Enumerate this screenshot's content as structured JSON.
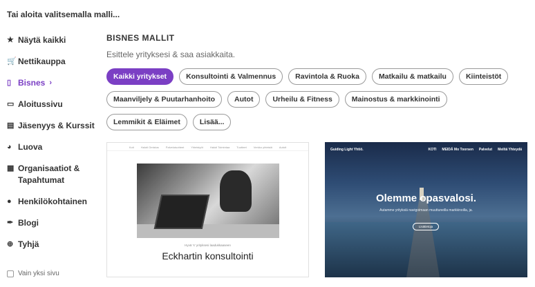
{
  "heading": "Tai aloita valitsemalla malli...",
  "sidebar": {
    "items": [
      {
        "label": "Näytä kaikki",
        "icon": "★"
      },
      {
        "label": "Nettikauppa",
        "icon": "🛒"
      },
      {
        "label": "Bisnes",
        "icon": "▯",
        "chevron": "›"
      },
      {
        "label": "Aloitussivu",
        "icon": "▭"
      },
      {
        "label": "Jäsenyys & Kurssit",
        "icon": "▤"
      },
      {
        "label": "Luova",
        "icon": "◕"
      },
      {
        "label": "Organisaatiot & Tapahtumat",
        "icon": "▦"
      },
      {
        "label": "Henkilökohtainen",
        "icon": "●"
      },
      {
        "label": "Blogi",
        "icon": "✒"
      },
      {
        "label": "Tyhjä",
        "icon": "⊕"
      }
    ],
    "checkbox_label": "Vain yksi sivu"
  },
  "main": {
    "title": "BISNES MALLIT",
    "subtitle": "Esittele yrityksesi & saa asiakkaita.",
    "chips": [
      "Kaikki yritykset",
      "Konsultointi & Valmennus",
      "Ravintola & Ruoka",
      "Matkailu & matkailu",
      "Kiinteistöt",
      "Maanviljely & Puutarhanhoito",
      "Autot",
      "Urheilu & Fitness",
      "Mainostus & markkinointi",
      "Lemmikit & Eläimet",
      "Lisää..."
    ]
  },
  "templates": {
    "t1": {
      "nav": [
        "Koti",
        "Haluti Omistus",
        "Palvelutuotteet",
        "Yhteistyöt",
        "Haluti Toimintaa",
        "Tuotteet",
        "Verkko yhteistä",
        "Autoit"
      ],
      "tagline": "Hyvä 's' yrityksesi laadukkaaseen",
      "title": "Eckhartin konsultointi"
    },
    "t2": {
      "brand": "Guiding Light Yhtiö.",
      "nav": [
        "KOTI",
        "MEIDÄ Mo Toorsen",
        "Palvelut",
        "Meiltä Yhteydä"
      ],
      "headline": "Olemme opasvalosi.",
      "sub": "Autamme yrityksiä navigoimaan muuttuneilla markkinoilla, ja.",
      "button": "Lisätietoja"
    }
  },
  "colors": {
    "accent": "#7b3fc4"
  }
}
